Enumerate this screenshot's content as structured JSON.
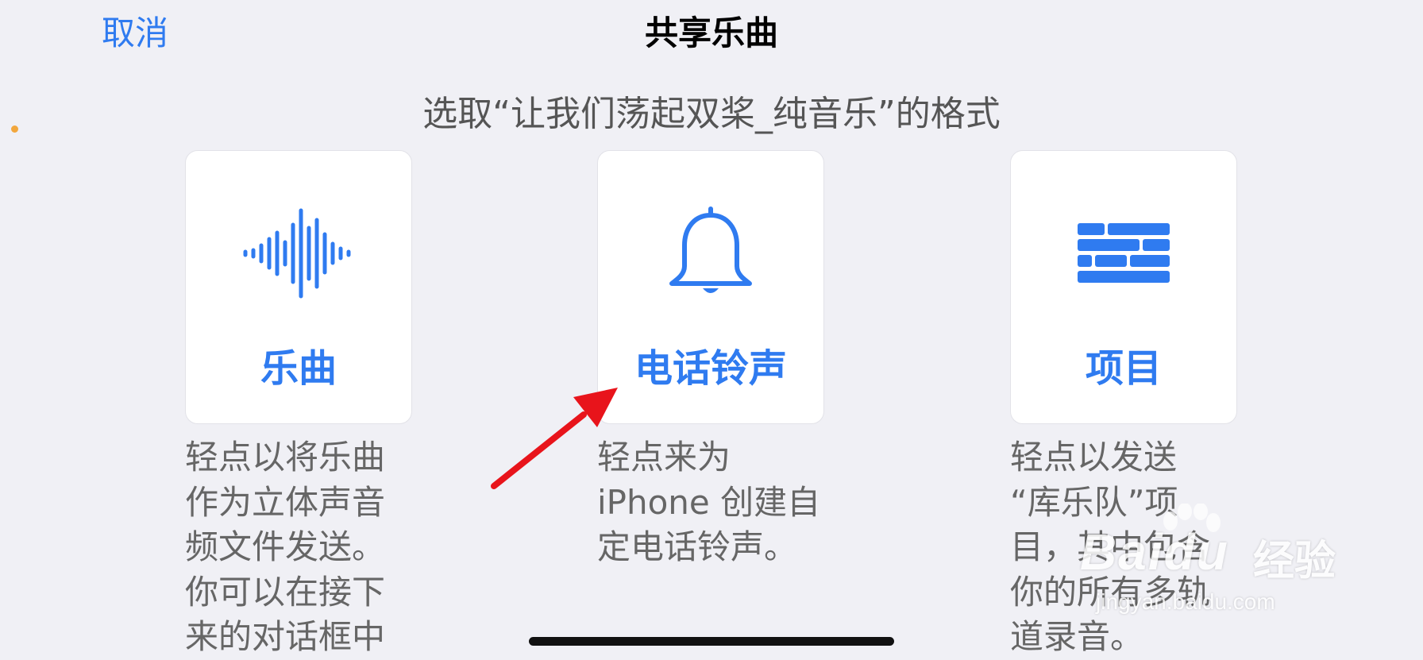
{
  "header": {
    "cancel_label": "取消",
    "title": "共享乐曲"
  },
  "subtitle": "选取“让我们荡起双桨_纯音乐”的格式",
  "options": [
    {
      "icon": "waveform-icon",
      "label": "乐曲",
      "description": "轻点以将乐曲\n作为立体声音\n频文件发送。\n你可以在接下\n来的对话框中"
    },
    {
      "icon": "bell-icon",
      "label": "电话铃声",
      "description": "轻点来为\niPhone 创建自\n定电话铃声。"
    },
    {
      "icon": "bricks-icon",
      "label": "项目",
      "description": "轻点以发送\n“库乐队”项\n目，其中包含\n你的所有多轨\n道录音。"
    }
  ],
  "watermark": {
    "brand": "Baidu",
    "cn": "经验",
    "url": "jingyan.baidu.com"
  },
  "colors": {
    "accent": "#2f7bf0",
    "background": "#f0f0f5",
    "annotation_arrow": "#e8141b"
  }
}
